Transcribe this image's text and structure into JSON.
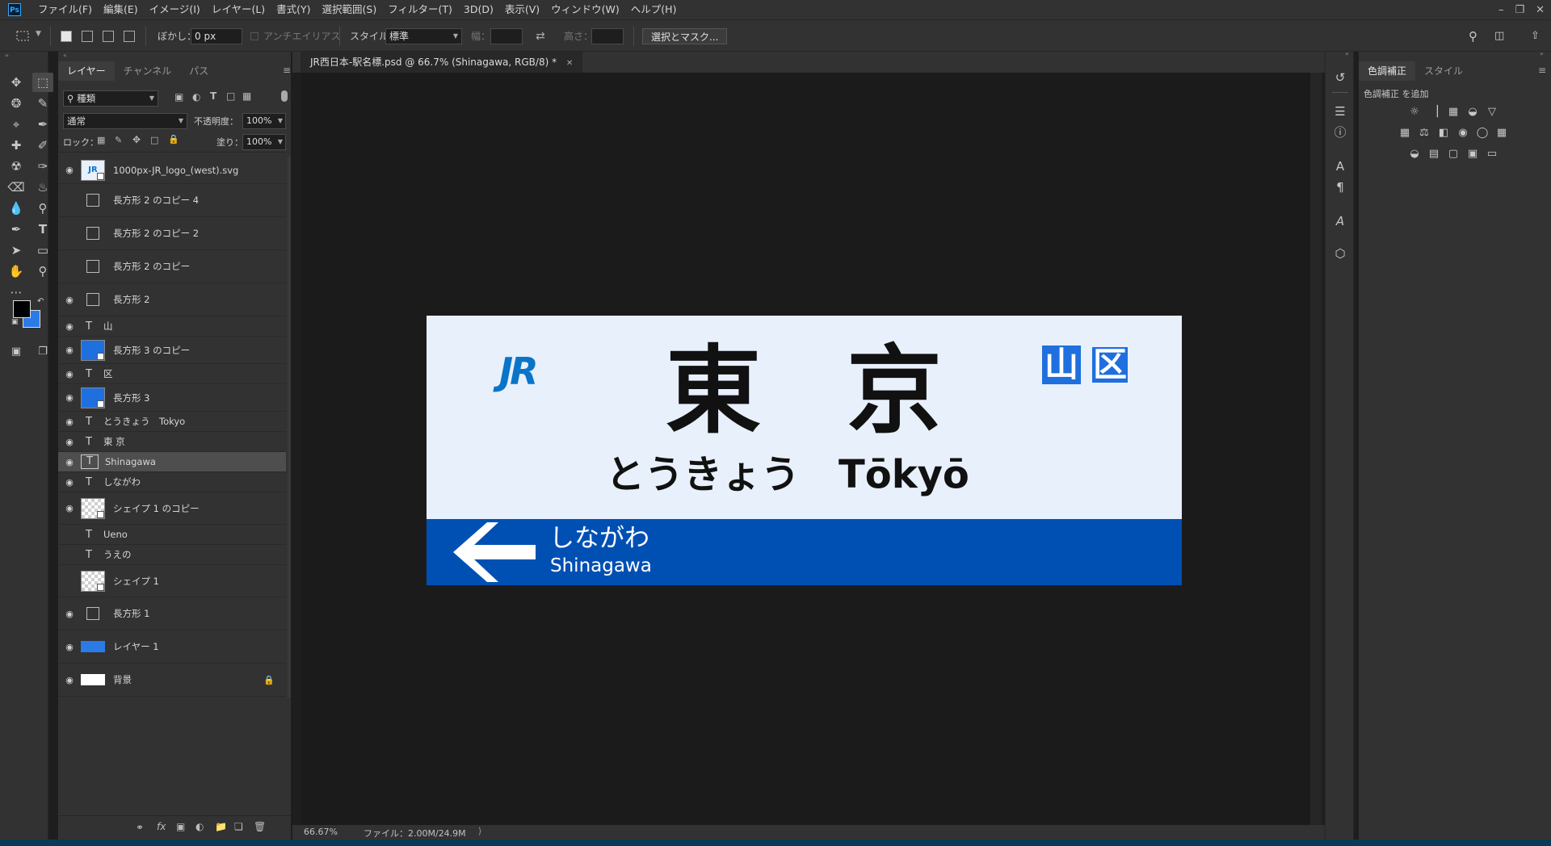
{
  "menu": [
    "ファイル(F)",
    "編集(E)",
    "イメージ(I)",
    "レイヤー(L)",
    "書式(Y)",
    "選択範囲(S)",
    "フィルター(T)",
    "3D(D)",
    "表示(V)",
    "ウィンドウ(W)",
    "ヘルプ(H)"
  ],
  "app_logo": "Ps",
  "options": {
    "feather_label": "ぼかし：",
    "feather_value": "0 px",
    "antialias_label": "アンチエイリアス",
    "style_label": "スタイル：",
    "style_value": "標準",
    "width_label": "幅：",
    "height_label": "高さ：",
    "select_mask_button": "選択とマスク..."
  },
  "layers_panel": {
    "tabs": [
      "レイヤー",
      "チャンネル",
      "パス"
    ],
    "filter_kind": "種類",
    "blend_mode": "通常",
    "opacity_label": "不透明度：",
    "opacity_value": "100%",
    "lock_label": "ロック：",
    "fill_label": "塗り：",
    "fill_value": "100%",
    "layers": [
      {
        "name": "1000px-JR_logo_(west).svg",
        "visible": true,
        "thumb": "smart-logo"
      },
      {
        "name": "長方形 2 のコピー 4",
        "visible": false,
        "thumb": "shape"
      },
      {
        "name": "長方形 2 のコピー 2",
        "visible": false,
        "thumb": "shape"
      },
      {
        "name": "長方形 2 のコピー",
        "visible": false,
        "thumb": "shape"
      },
      {
        "name": "長方形 2",
        "visible": true,
        "thumb": "shape"
      },
      {
        "name": "山",
        "visible": true,
        "thumb": "text"
      },
      {
        "name": "長方形 3 のコピー",
        "visible": true,
        "thumb": "blue-shape"
      },
      {
        "name": "区",
        "visible": true,
        "thumb": "text"
      },
      {
        "name": "長方形 3",
        "visible": true,
        "thumb": "blue-shape"
      },
      {
        "name": "とうきょう　Tokyo",
        "visible": true,
        "thumb": "text"
      },
      {
        "name": "東 京",
        "visible": true,
        "thumb": "text"
      },
      {
        "name": "Shinagawa",
        "visible": true,
        "thumb": "text-selected"
      },
      {
        "name": "しながわ",
        "visible": true,
        "thumb": "text"
      },
      {
        "name": "シェイプ 1 のコピー",
        "visible": true,
        "thumb": "transparent-shape"
      },
      {
        "name": "Ueno",
        "visible": false,
        "thumb": "text"
      },
      {
        "name": "うえの",
        "visible": false,
        "thumb": "text"
      },
      {
        "name": "シェイプ 1",
        "visible": false,
        "thumb": "transparent-shape"
      },
      {
        "name": "長方形 1",
        "visible": true,
        "thumb": "shape"
      },
      {
        "name": "レイヤー 1",
        "visible": true,
        "thumb": "blue-fill"
      },
      {
        "name": "背景",
        "visible": true,
        "thumb": "white-fill"
      }
    ]
  },
  "document": {
    "tab_title": "JR西日本-駅名標.psd @ 66.7% (Shinagawa, RGB/8) *",
    "zoom": "66.67%",
    "file_info": "ファイル：2.00M/24.9M"
  },
  "sign": {
    "logo": "JR",
    "kanji_1": "東",
    "kanji_2": "京",
    "kana_romaji": "とうきょう　Tōkyō",
    "line_mark_1": "山",
    "line_mark_2": "区",
    "next_kana": "しながわ",
    "next_romaji": "Shinagawa"
  },
  "adjustments_panel": {
    "tabs": [
      "色調補正",
      "スタイル"
    ],
    "hint": "色調補正 を追加"
  },
  "colors": {
    "sign_background": "#e8f0fc",
    "band_blue": "#0050b4",
    "jr_logo_blue": "#0a74c8",
    "line_box_blue": "#1f6fde",
    "foreground": "#000000",
    "background": "#2a7be8"
  }
}
